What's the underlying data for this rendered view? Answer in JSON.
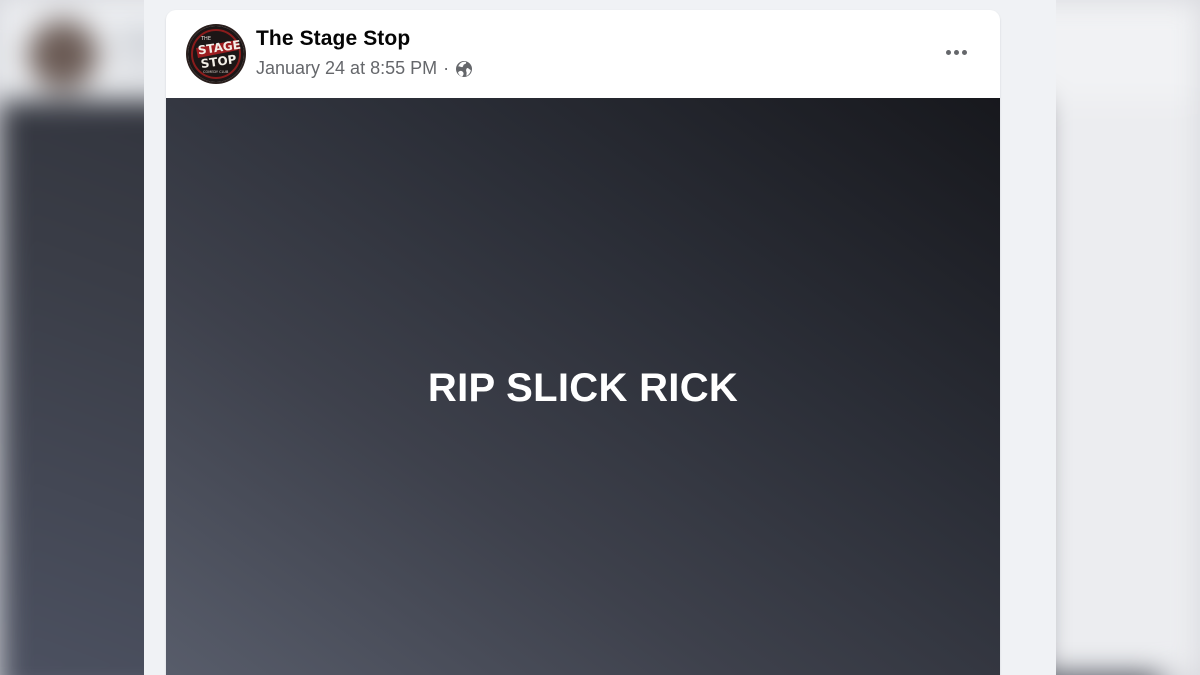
{
  "post": {
    "page_name": "The Stage Stop",
    "timestamp": "January 24 at 8:55 PM",
    "separator": "·",
    "audience_icon": "globe-icon",
    "more_icon": "more-options-icon",
    "text": "RIP SLICK RICK",
    "avatar": {
      "logo_text_line1": "STAGE",
      "logo_text_line2": "STOP",
      "logo_small_top": "THE",
      "logo_small_bottom": "COMEDY CLUB"
    }
  },
  "colors": {
    "card_background": "#ffffff",
    "feed_background": "#f0f2f5",
    "name_text": "#050505",
    "meta_text": "#65676b",
    "media_dark": "#17181d",
    "media_light": "#595e6c",
    "post_text": "#ffffff"
  }
}
